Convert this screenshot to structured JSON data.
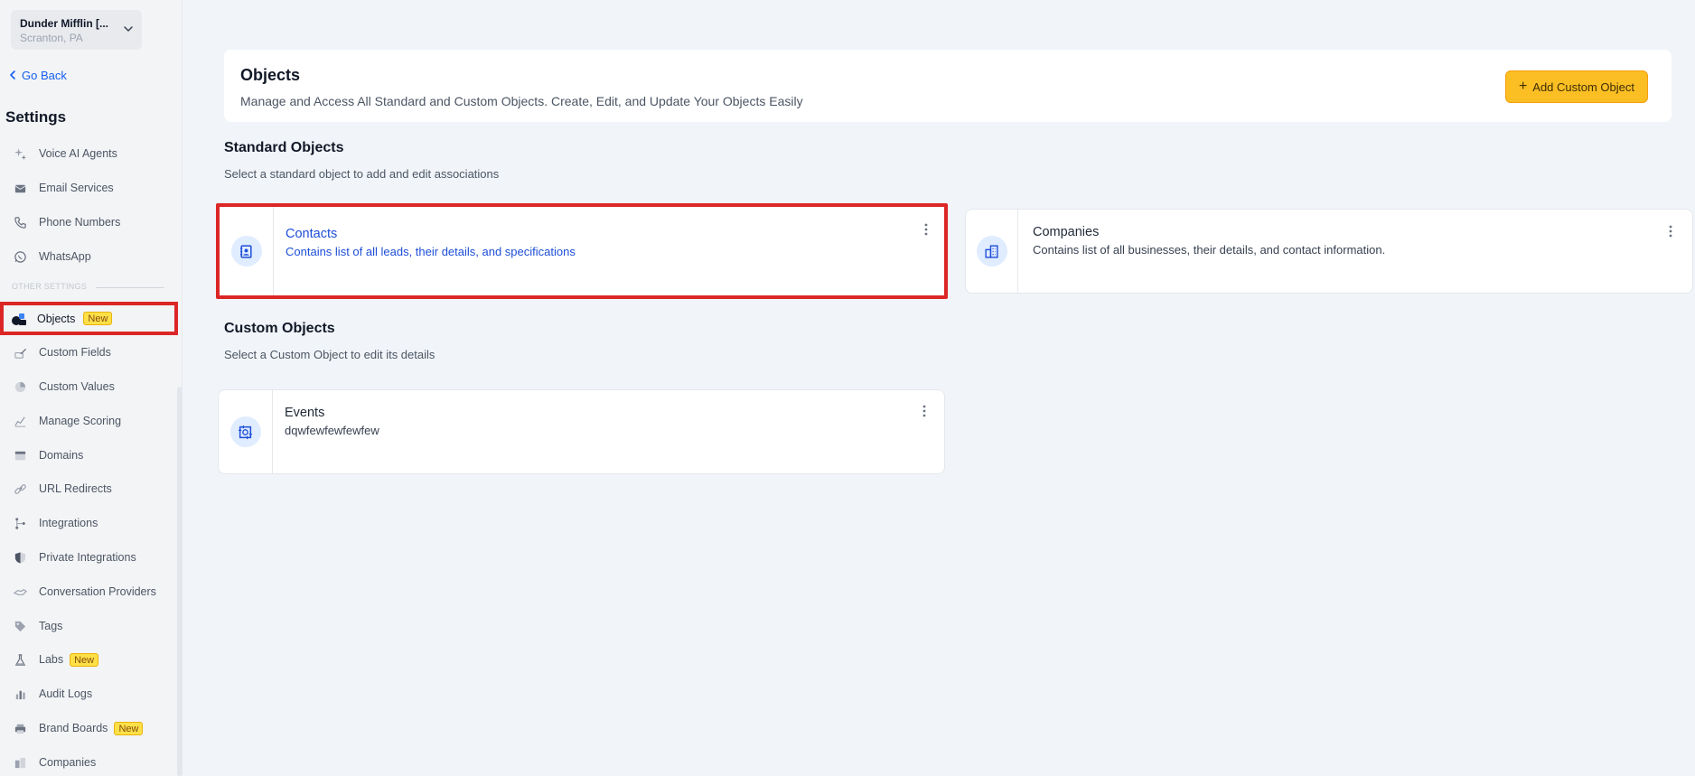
{
  "location": {
    "name": "Dunder Mifflin [...",
    "address": "Scranton, PA"
  },
  "nav": {
    "go_back": "Go Back",
    "settings_title": "Settings",
    "items_top": [
      {
        "label": "Voice AI Agents",
        "icon": "sparkles-icon"
      },
      {
        "label": "Email Services",
        "icon": "mail-icon"
      },
      {
        "label": "Phone Numbers",
        "icon": "phone-icon"
      },
      {
        "label": "WhatsApp",
        "icon": "whatsapp-icon"
      }
    ],
    "other_settings_label": "OTHER SETTINGS",
    "active_item": {
      "label": "Objects",
      "badge": "New",
      "icon": "objects-icon"
    },
    "items_bottom": [
      {
        "label": "Custom Fields",
        "icon": "edit-icon"
      },
      {
        "label": "Custom Values",
        "icon": "pie-chart-icon"
      },
      {
        "label": "Manage Scoring",
        "icon": "chart-line-icon"
      },
      {
        "label": "Domains",
        "icon": "browser-icon"
      },
      {
        "label": "URL Redirects",
        "icon": "link-icon"
      },
      {
        "label": "Integrations",
        "icon": "git-branch-icon"
      },
      {
        "label": "Private Integrations",
        "icon": "shield-icon"
      },
      {
        "label": "Conversation Providers",
        "icon": "handshake-icon"
      },
      {
        "label": "Tags",
        "icon": "tag-icon"
      },
      {
        "label": "Labs",
        "badge": "New",
        "icon": "flask-icon"
      },
      {
        "label": "Audit Logs",
        "icon": "bar-chart-icon"
      },
      {
        "label": "Brand Boards",
        "badge": "New",
        "icon": "printer-icon"
      },
      {
        "label": "Companies",
        "icon": "buildings-icon"
      }
    ]
  },
  "header": {
    "title": "Objects",
    "subtitle": "Manage and Access All Standard and Custom Objects. Create, Edit, and Update Your Objects Easily",
    "add_button": "Add Custom Object",
    "add_button_icon": "+"
  },
  "standard": {
    "title": "Standard Objects",
    "description": "Select a standard object to add and edit associations",
    "cards": [
      {
        "title": "Contacts",
        "description": "Contains list of all leads, their details, and specifications",
        "icon": "contact-book-icon",
        "selected": true
      },
      {
        "title": "Companies",
        "description": "Contains list of all businesses, their details, and contact information.",
        "icon": "building-icon",
        "selected": false
      }
    ]
  },
  "custom": {
    "title": "Custom Objects",
    "description": "Select a Custom Object to edit its details",
    "cards": [
      {
        "title": "Events",
        "description": "dqwfewfewfewfew",
        "icon": "custom-object-icon"
      }
    ]
  },
  "colors": {
    "accent_blue": "#155eef",
    "highlight_red": "#dc2626",
    "button_yellow": "#fbbf24",
    "badge_yellow": "#fde047",
    "background": "#f1f5f9"
  }
}
